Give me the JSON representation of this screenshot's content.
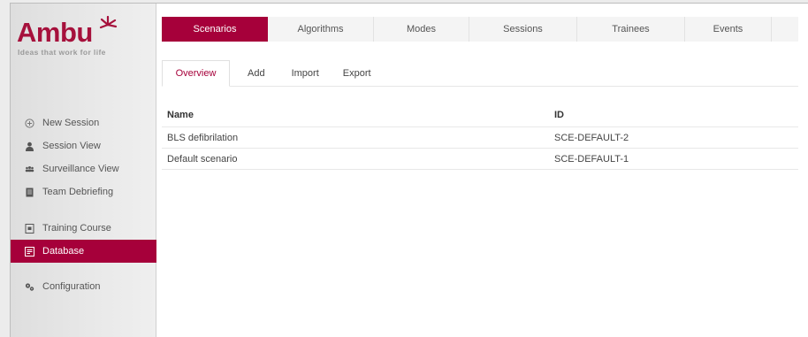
{
  "brand": {
    "name": "Ambu",
    "tagline": "Ideas that work for life",
    "accent_color": "#a6003a"
  },
  "sidebar": {
    "items": [
      {
        "label": "New Session",
        "icon": "plus-circle-icon",
        "active": false
      },
      {
        "label": "Session View",
        "icon": "person-icon",
        "active": false
      },
      {
        "label": "Surveillance View",
        "icon": "group-icon",
        "active": false
      },
      {
        "label": "Team Debriefing",
        "icon": "document-icon",
        "active": false
      },
      {
        "label": "Training Course",
        "icon": "course-icon",
        "active": false
      },
      {
        "label": "Database",
        "icon": "database-icon",
        "active": true
      },
      {
        "label": "Configuration",
        "icon": "gears-icon",
        "active": false
      }
    ]
  },
  "tabs": [
    {
      "label": "Scenarios",
      "active": true
    },
    {
      "label": "Algorithms",
      "active": false
    },
    {
      "label": "Modes",
      "active": false
    },
    {
      "label": "Sessions",
      "active": false
    },
    {
      "label": "Trainees",
      "active": false
    },
    {
      "label": "Events",
      "active": false
    }
  ],
  "subtabs": [
    {
      "label": "Overview",
      "active": true
    },
    {
      "label": "Add",
      "active": false
    },
    {
      "label": "Import",
      "active": false
    },
    {
      "label": "Export",
      "active": false
    }
  ],
  "table": {
    "columns": [
      "Name",
      "ID"
    ],
    "rows": [
      [
        "BLS defibrilation",
        "SCE-DEFAULT-2"
      ],
      [
        "Default scenario",
        "SCE-DEFAULT-1"
      ]
    ]
  }
}
